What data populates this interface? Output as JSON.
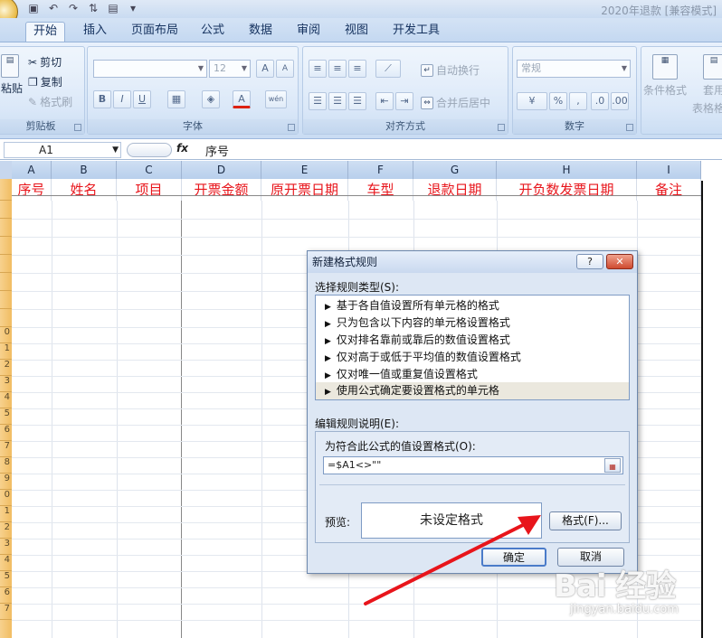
{
  "title_bar": {
    "qat_icons": [
      "save-icon",
      "undo-icon",
      "redo-icon",
      "sort-icon",
      "print-preview-icon",
      "customize-icon"
    ],
    "window_title": "2020年退款  [兼容模式]"
  },
  "tabs": [
    "开始",
    "插入",
    "页面布局",
    "公式",
    "数据",
    "审阅",
    "视图",
    "开发工具"
  ],
  "ribbon": {
    "clipboard": {
      "paste": "粘贴",
      "cut": "剪切",
      "copy": "复制",
      "format_painter": "格式刷",
      "label": "剪贴板"
    },
    "font": {
      "font_size": "12",
      "grow": "A",
      "shrink": "A",
      "bold": "B",
      "italic": "I",
      "underline": "U",
      "font_color": "A",
      "phonetic": "wén",
      "label": "字体"
    },
    "alignment": {
      "wrap": "自动换行",
      "merge": "合并后居中",
      "label": "对齐方式"
    },
    "number": {
      "format": "常规",
      "percent": "%",
      "comma": ",",
      "label": "数字"
    },
    "styles": {
      "conditional": "条件格式",
      "table": "套用",
      "table2": "表格格"
    }
  },
  "formula_bar": {
    "name_box": "A1",
    "fx": "fx",
    "content": "序号"
  },
  "sheet": {
    "columns": [
      "A",
      "B",
      "C",
      "D",
      "E",
      "F",
      "G",
      "H",
      "I"
    ],
    "header_cells": [
      "序号",
      "姓名",
      "项目",
      "开票金额",
      "原开票日期",
      "车型",
      "退款日期",
      "开负数发票日期",
      "备注"
    ],
    "row_numbers": [
      "0",
      "1",
      "2",
      "3",
      "4",
      "5",
      "6",
      "7",
      "8",
      "9",
      "0",
      "1",
      "2",
      "3",
      "4",
      "5",
      "6",
      "7"
    ]
  },
  "dialog": {
    "title": "新建格式规则",
    "help": "?",
    "close": "✕",
    "select_type_label": "选择规则类型(S):",
    "rule_types": [
      "基于各自值设置所有单元格的格式",
      "只为包含以下内容的单元格设置格式",
      "仅对排名靠前或靠后的数值设置格式",
      "仅对高于或低于平均值的数值设置格式",
      "仅对唯一值或重复值设置格式",
      "使用公式确定要设置格式的单元格"
    ],
    "selected_index": 5,
    "edit_label": "编辑规则说明(E):",
    "formula_label": "为符合此公式的值设置格式(O):",
    "formula_value": "=$A1<>\"\"",
    "preview_label": "预览:",
    "preview_text": "未设定格式",
    "format_button": "格式(F)...",
    "ok_button": "确定",
    "cancel_button": "取消"
  },
  "watermark": {
    "main": "Bai 经验",
    "sub": "jingyan.baidu.com"
  },
  "colors": {
    "header_text": "#e8151b",
    "arrow": "#e8151b",
    "ribbon_bg": "#d6e5f7"
  }
}
